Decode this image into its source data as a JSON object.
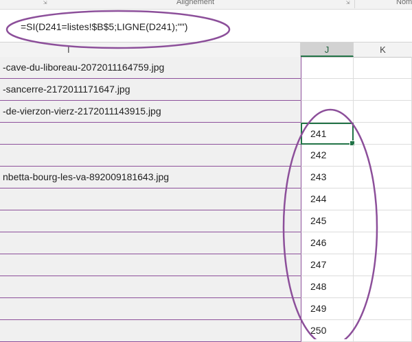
{
  "ribbon": {
    "groups": [
      {
        "label": "Alignement"
      },
      {
        "label": "Nom"
      }
    ]
  },
  "formula_bar": {
    "formula": "=SI(D241=listes!$B$5;LIGNE(D241);\"\")"
  },
  "columns": [
    {
      "label": "I",
      "selected": false
    },
    {
      "label": "J",
      "selected": true
    },
    {
      "label": "K",
      "selected": false
    }
  ],
  "rows": [
    {
      "i": "-cave-du-liboreau-2072011164759.jpg",
      "j": ""
    },
    {
      "i": "-sancerre-2172011171647.jpg",
      "j": ""
    },
    {
      "i": "-de-vierzon-vierz-2172011143915.jpg",
      "j": ""
    },
    {
      "i": "",
      "j": "241",
      "active": true
    },
    {
      "i": "",
      "j": "242"
    },
    {
      "i": "nbetta-bourg-les-va-892009181643.jpg",
      "j": "243"
    },
    {
      "i": "",
      "j": "244"
    },
    {
      "i": "",
      "j": "245"
    },
    {
      "i": "",
      "j": "246"
    },
    {
      "i": "",
      "j": "247"
    },
    {
      "i": "",
      "j": "248"
    },
    {
      "i": "",
      "j": "249"
    },
    {
      "i": "",
      "j": "250"
    }
  ],
  "colors": {
    "annotation": "#8c4f9a",
    "selection": "#217346"
  }
}
